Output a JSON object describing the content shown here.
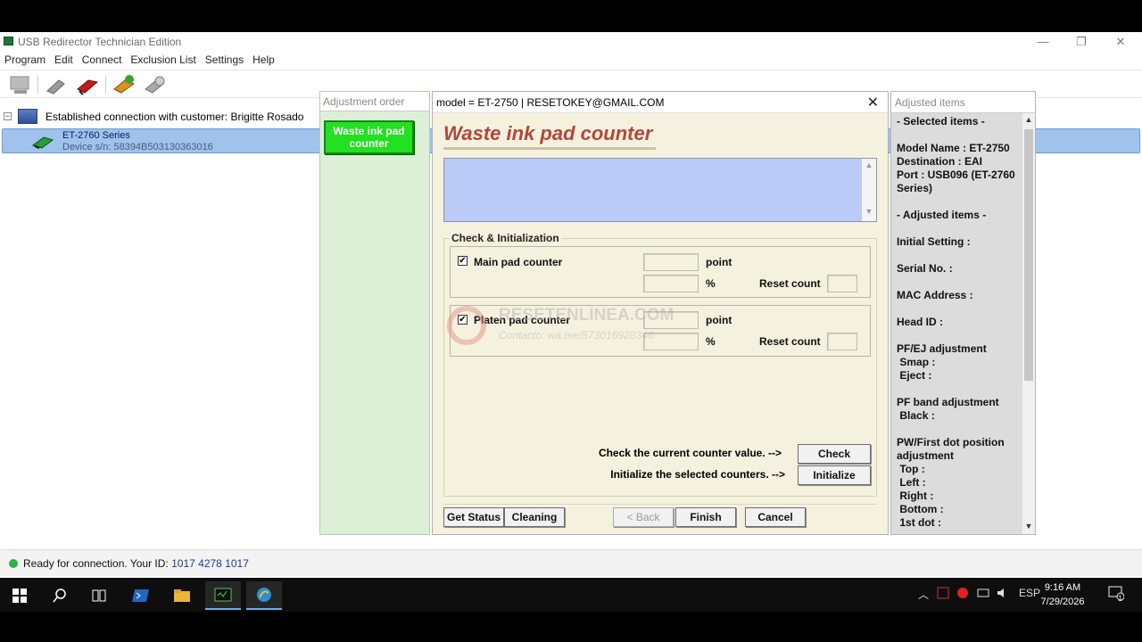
{
  "app": {
    "title": "USB Redirector Technician Edition",
    "menu": [
      "Program",
      "Edit",
      "Connect",
      "Exclusion List",
      "Settings",
      "Help"
    ],
    "window_controls": {
      "minimize": "—",
      "restore": "❐",
      "close": "✕"
    }
  },
  "toolbar": {
    "buttons": [
      "computer-icon",
      "plug-icon",
      "disconnect-icon",
      "connect-device-icon",
      "settings-plug-icon"
    ]
  },
  "tree": {
    "root_label": "Established connection with customer: Brigitte Rosado",
    "expander": "−",
    "device_name": "ET-2760 Series",
    "device_sn": "Device s/n: 58394B503130363016"
  },
  "status": {
    "text": "Ready for connection. Your ID: ",
    "id": "1017 4278 1017",
    "color": "#2db34a"
  },
  "adjustment_order": {
    "header": "Adjustment order",
    "active_item": "Waste ink pad counter"
  },
  "dialog": {
    "title": "model = ET-2750 | RESETOKEY@GMAIL.COM",
    "heading": "Waste ink pad counter",
    "group_label": "Check & Initialization",
    "main_pad": {
      "label": "Main pad counter",
      "checked": "✔",
      "unit_point": "point",
      "unit_pct": "%",
      "reset_label": "Reset count"
    },
    "platen_pad": {
      "label": "Platen pad counter",
      "checked": "✔",
      "unit_point": "point",
      "unit_pct": "%",
      "reset_label": "Reset count"
    },
    "check_text": "Check the current counter value. -->",
    "check_button": "Check",
    "init_text": "Initialize the selected counters. -->",
    "init_button": "Initialize",
    "footer": {
      "get_status": "Get Status",
      "cleaning": "Cleaning",
      "back": "< Back",
      "finish": "Finish",
      "cancel": "Cancel"
    },
    "watermark": {
      "brand": "RESETENLINEA.COM",
      "contact": "Contacto: wa.me/573016928346"
    }
  },
  "adjusted_items": {
    "header": "Adjusted items",
    "lines": [
      "- Selected items -",
      "",
      "Model Name : ET-2750",
      "Destination : EAI",
      "Port : USB096 (ET-2760",
      "Series)",
      "",
      "- Adjusted items -",
      "",
      "Initial Setting :",
      "",
      "Serial No. :",
      "",
      "MAC Address :",
      "",
      "Head ID :",
      "",
      "PF/EJ adjustment",
      " Smap :",
      " Eject :",
      "",
      "PF band adjustment",
      " Black :",
      "",
      "PW/First dot position",
      "adjustment",
      " Top :",
      " Left :",
      " Right :",
      " Bottom :",
      " 1st dot :"
    ]
  },
  "taskbar": {
    "apps": [
      "windows-start-icon",
      "search-icon",
      "task-view-icon",
      "powershell-icon",
      "file-explorer-icon",
      "terminal-icon",
      "browser-icon"
    ],
    "language": "ESP",
    "time": "9:16 AM",
    "date": "7/29/2026",
    "notification_count": "1"
  }
}
